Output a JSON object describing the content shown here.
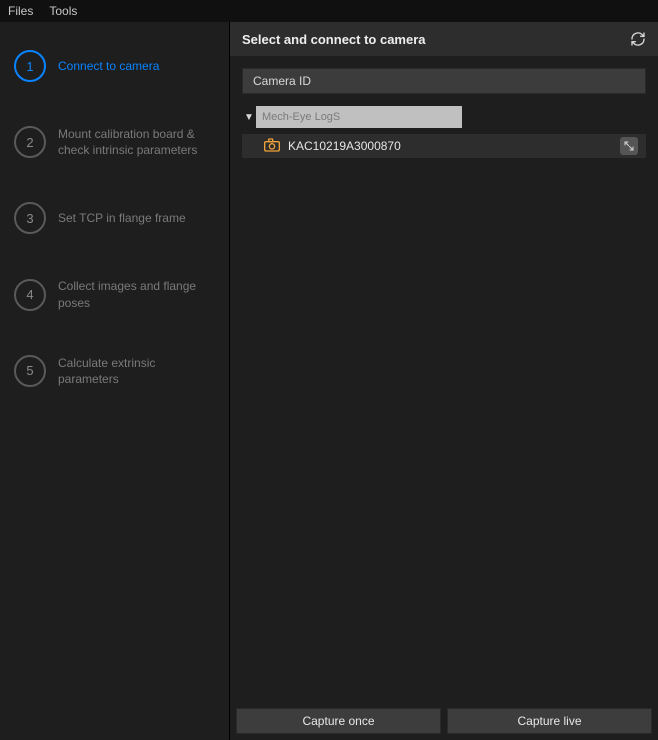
{
  "menu": {
    "files": "Files",
    "tools": "Tools"
  },
  "steps": [
    {
      "num": "1",
      "label": "Connect to camera"
    },
    {
      "num": "2",
      "label": "Mount calibration board & check intrinsic parameters"
    },
    {
      "num": "3",
      "label": "Set TCP in flange frame"
    },
    {
      "num": "4",
      "label": "Collect images and flange poses"
    },
    {
      "num": "5",
      "label": "Calculate extrinsic parameters"
    }
  ],
  "main": {
    "title": "Select and connect to camera",
    "columnHeader": "Camera ID",
    "group": "Mech-Eye LogS",
    "cameraId": "KAC10219A3000870"
  },
  "footer": {
    "captureOnce": "Capture once",
    "captureLive": "Capture live"
  }
}
